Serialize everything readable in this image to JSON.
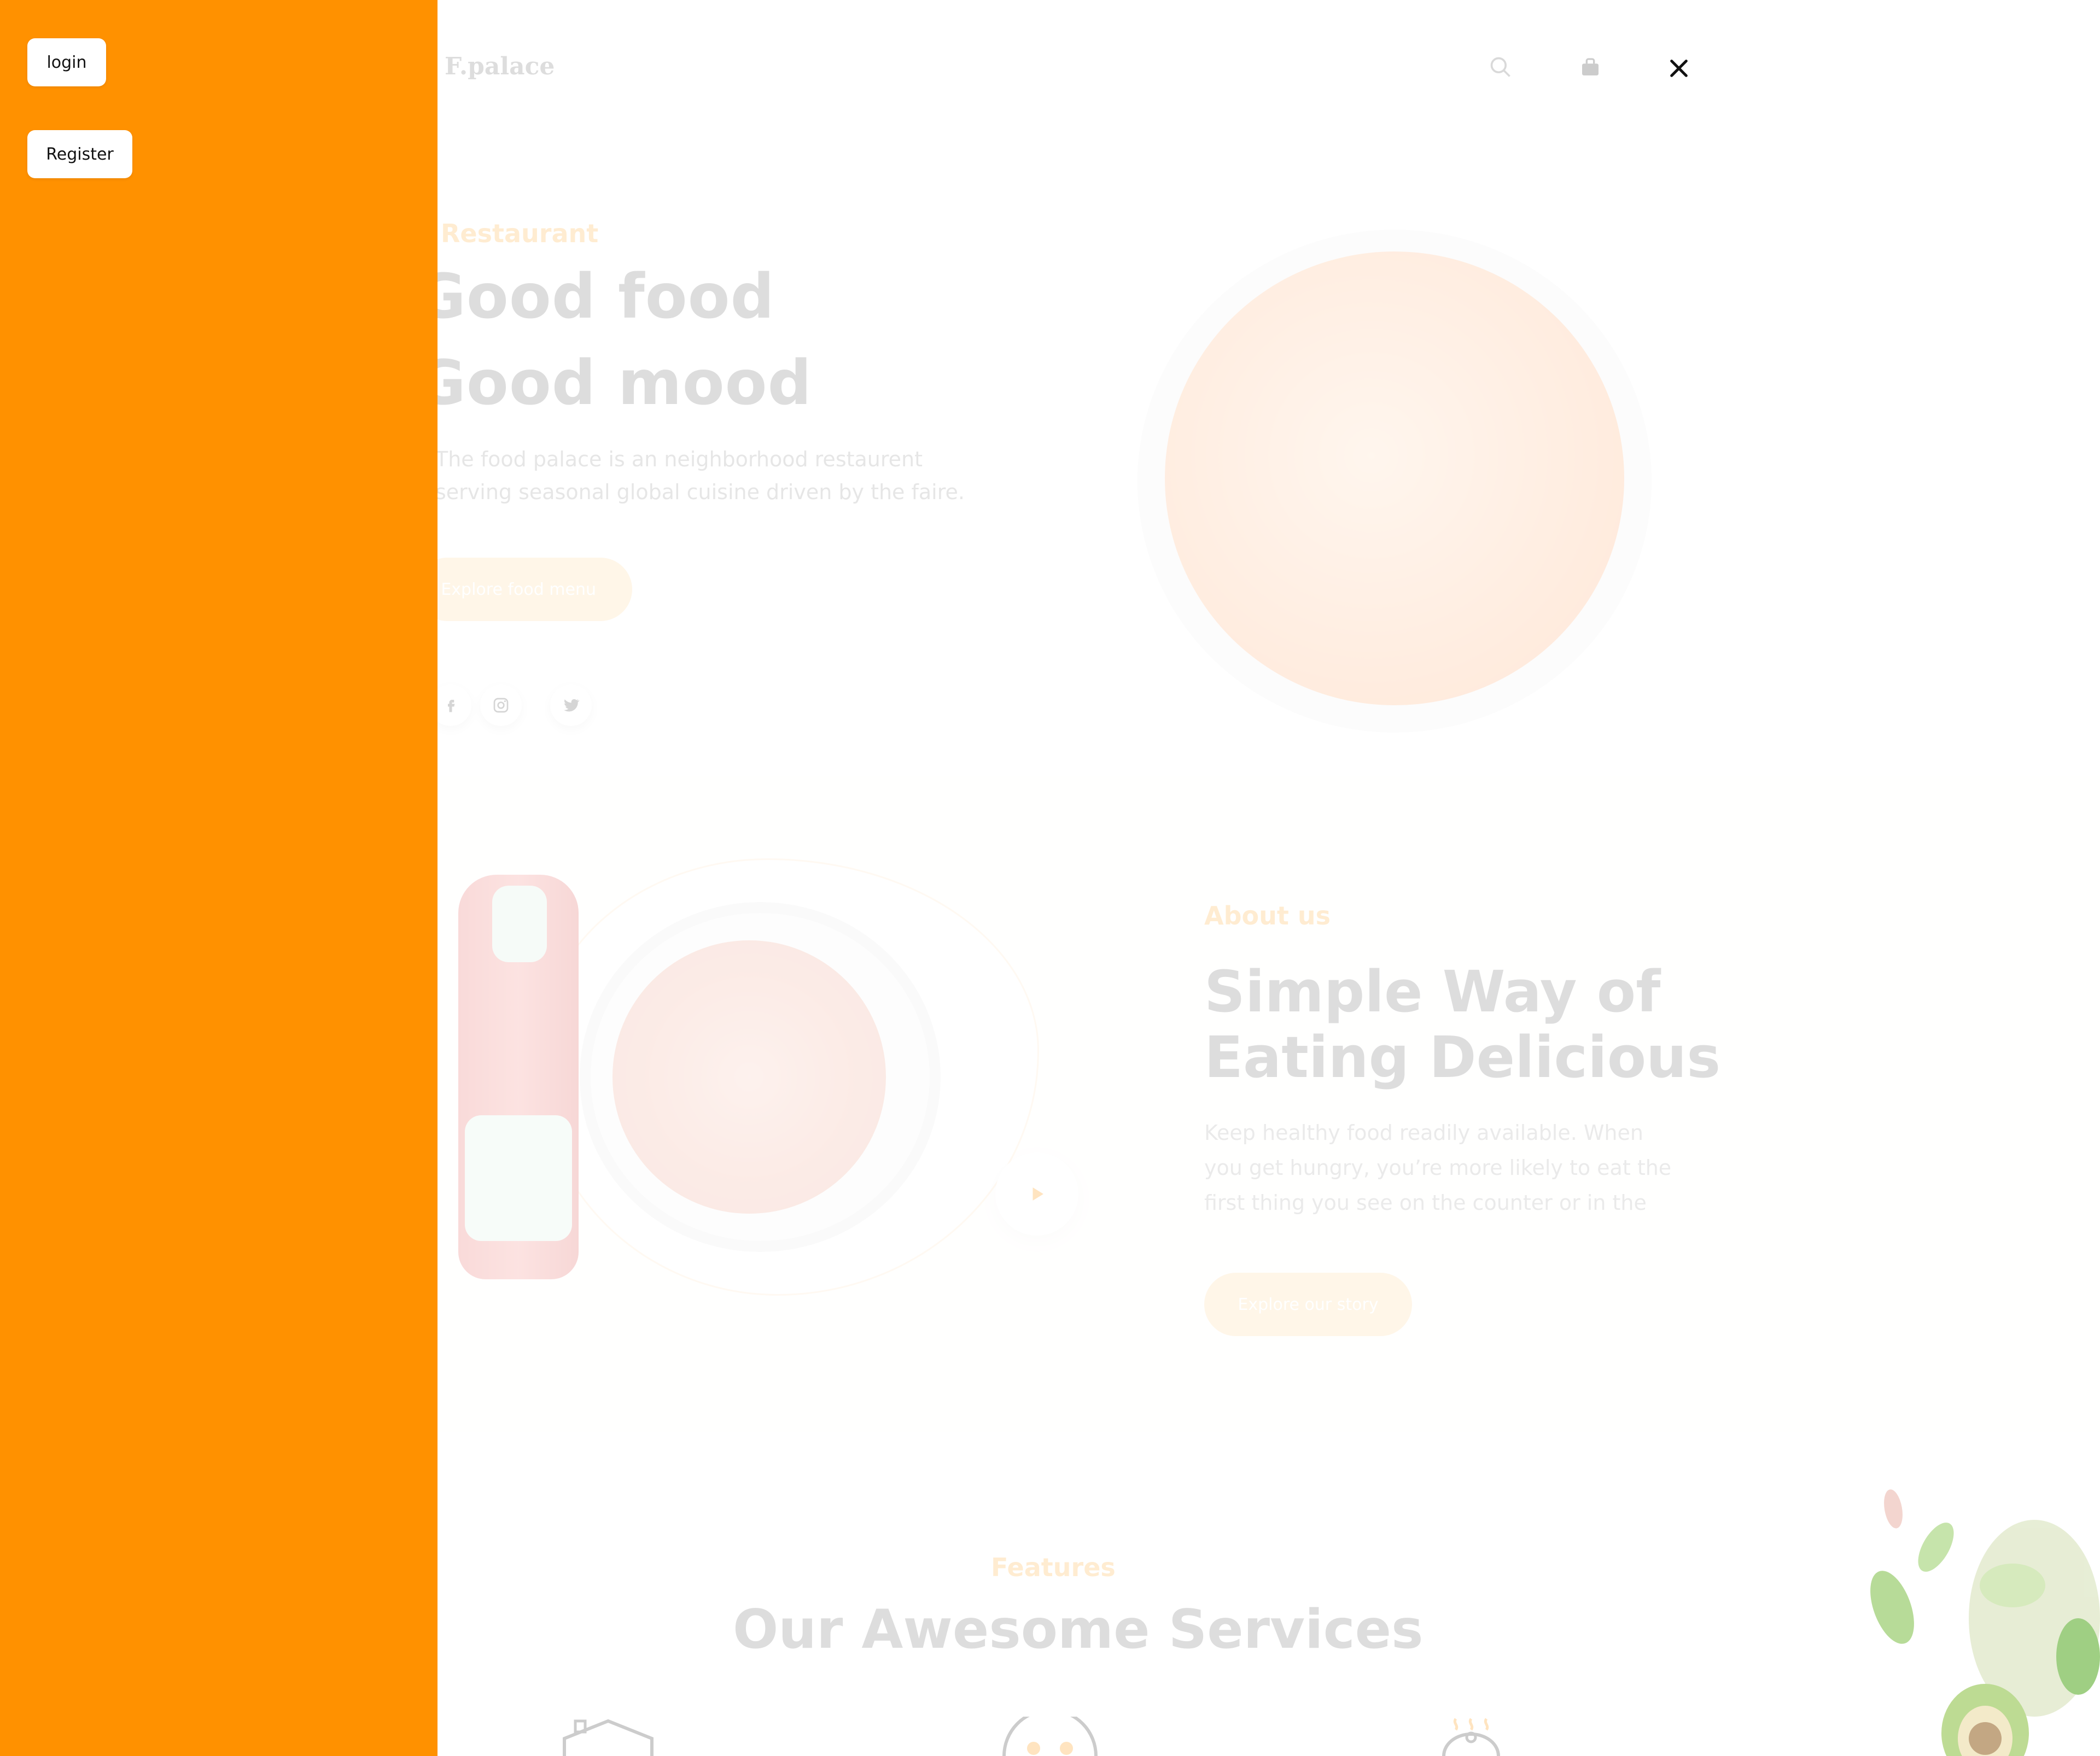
{
  "drawer": {
    "login_label": "login",
    "register_label": "Register",
    "background_color": "#ff9100"
  },
  "header": {
    "brand": "F.palace",
    "icons": [
      "search-icon",
      "bag-icon",
      "close-icon"
    ]
  },
  "hero": {
    "kicker": "Restaurant",
    "line1": "Good food",
    "line2": "Good mood",
    "description": "The food palace is an neighborhood restaurent serving seasonal global cuisine driven by the faire.",
    "cta_label": "Explore food menu",
    "social_icons": [
      "facebook-icon",
      "instagram-icon",
      "twitter-icon"
    ]
  },
  "about": {
    "kicker": "About us",
    "title": "Simple Way of Eating Delicious",
    "description": "Keep healthy food readily available. When you get hungry, you’re more likely to eat the first thing you see on the counter or in the",
    "cta_label": "Explore our story"
  },
  "features": {
    "kicker": "Features",
    "title": "Our Awesome Services",
    "icons": [
      "home-icon",
      "smile-icon",
      "hot-dish-icon"
    ]
  },
  "colors": {
    "accent": "#ff9100",
    "accent_light": "#ffb347"
  }
}
